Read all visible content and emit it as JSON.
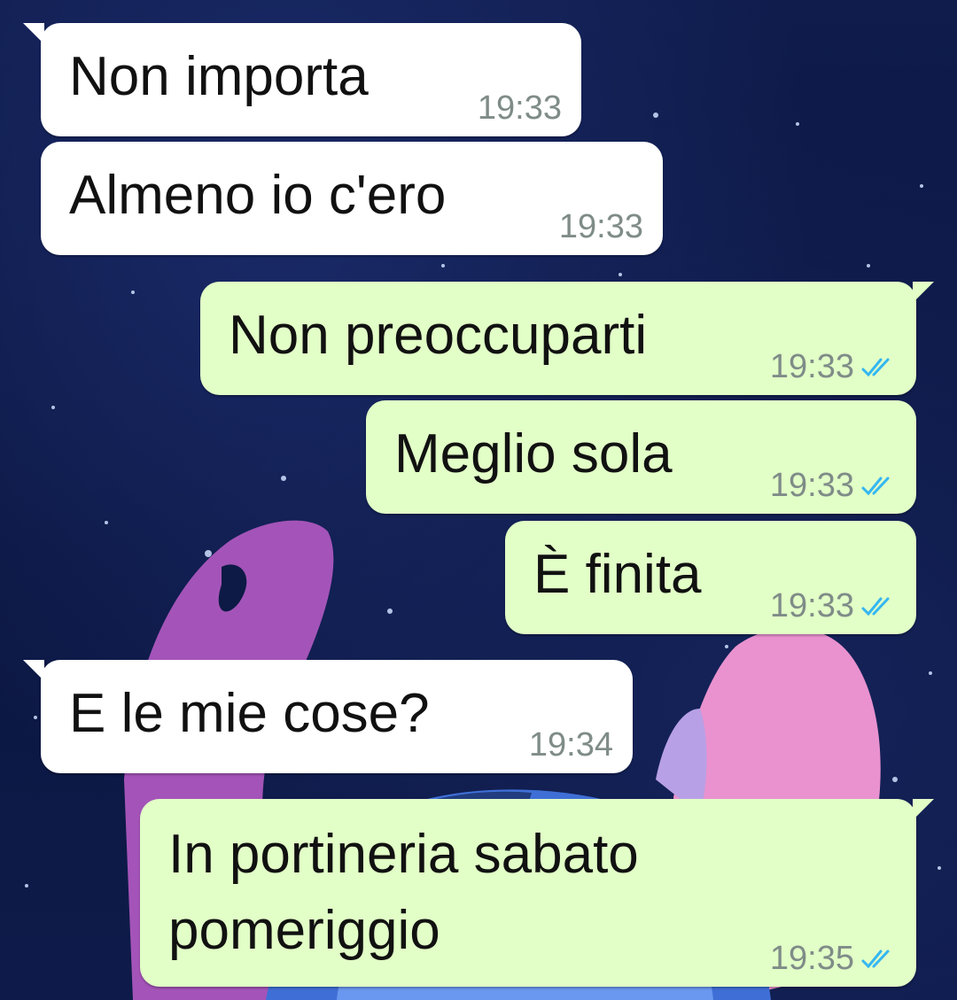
{
  "colors": {
    "incoming_bubble": "#ffffff",
    "outgoing_bubble": "#e2ffc7",
    "timestamp": "#7f8c88",
    "read_ticks": "#34b7f1",
    "wallpaper": "#0d1a45"
  },
  "messages": [
    {
      "direction": "incoming",
      "text": "Non importa",
      "time": "19:33"
    },
    {
      "direction": "incoming",
      "text": "Almeno io c'ero",
      "time": "19:33"
    },
    {
      "direction": "outgoing",
      "text": "Non preoccuparti",
      "time": "19:33",
      "status_icon": "double-check-icon"
    },
    {
      "direction": "outgoing",
      "text": "Meglio sola",
      "time": "19:33",
      "status_icon": "double-check-icon"
    },
    {
      "direction": "outgoing",
      "text": "È finita",
      "time": "19:33",
      "status_icon": "double-check-icon"
    },
    {
      "direction": "incoming",
      "text": "E le mie cose?",
      "time": "19:34"
    },
    {
      "direction": "outgoing",
      "text_line1": "In portineria sabato",
      "text_line2": "pomeriggio",
      "time": "19:35",
      "status_icon": "double-check-icon"
    }
  ]
}
